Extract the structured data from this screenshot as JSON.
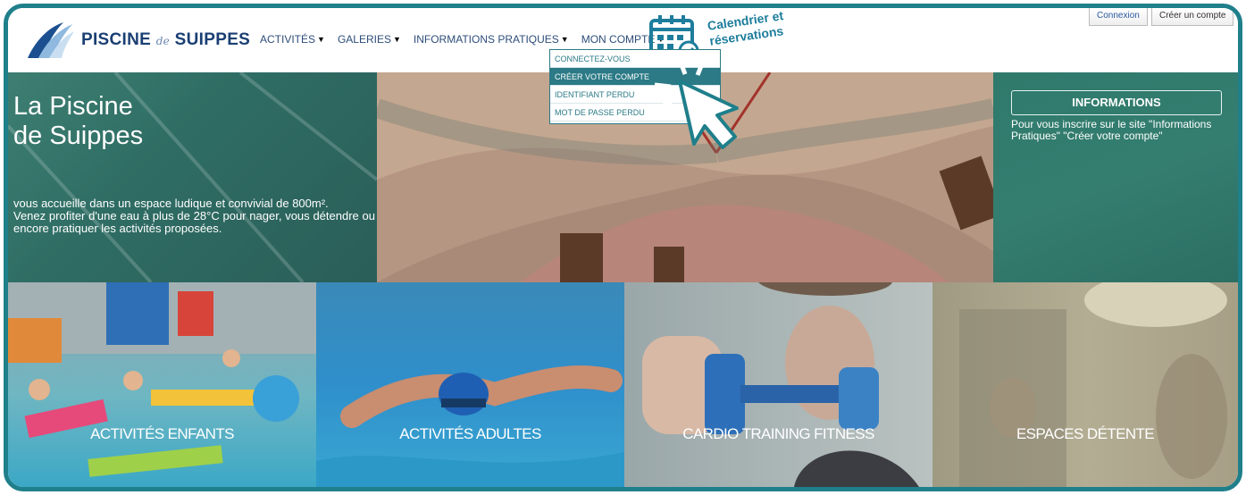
{
  "header": {
    "brand": {
      "name_part1": "PISCINE ",
      "name_de": "de",
      "name_part2": " SUIPPES"
    },
    "nav": [
      {
        "label": "ACTIVITÉS"
      },
      {
        "label": "GALERIES"
      },
      {
        "label": "INFORMATIONS PRATIQUES"
      },
      {
        "label": "MON COMPTE"
      }
    ],
    "calendar_line1": "Calendrier et",
    "calendar_line2": "réservations",
    "connexion": "Connexion",
    "create_account": "Créer un compte"
  },
  "dropdown": {
    "items": [
      {
        "label": "CONNECTEZ-VOUS"
      },
      {
        "label": "CRÉER VOTRE COMPTE"
      },
      {
        "label": "IDENTIFIANT PERDU"
      },
      {
        "label": "MOT DE PASSE PERDU"
      }
    ],
    "active_index": 1
  },
  "hero": {
    "title_line1": "La Piscine",
    "title_line2": "de Suippes",
    "desc_line1": "vous accueille dans un espace ludique et convivial de 800m².",
    "desc_line2": "Venez profiter d'une eau à plus de 28°C pour nager, vous détendre ou encore pratiquer les activités proposées.",
    "info_button": "INFORMATIONS",
    "info_text": "Pour vous inscrire sur le site \"Informations Pratiques\" \"Créer votre compte\""
  },
  "tiles": [
    {
      "label": "ACTIVITÉS ENFANTS"
    },
    {
      "label": "ACTIVITÉS ADULTES"
    },
    {
      "label": "CARDIO TRAINING FITNESS"
    },
    {
      "label": "ESPACES DÉTENTE"
    }
  ],
  "colors": {
    "frame": "#1f7f8b",
    "brand": "#1a3f73",
    "teal_overlay": "#2f6d64",
    "dropdown_accent": "#2b7a86"
  }
}
